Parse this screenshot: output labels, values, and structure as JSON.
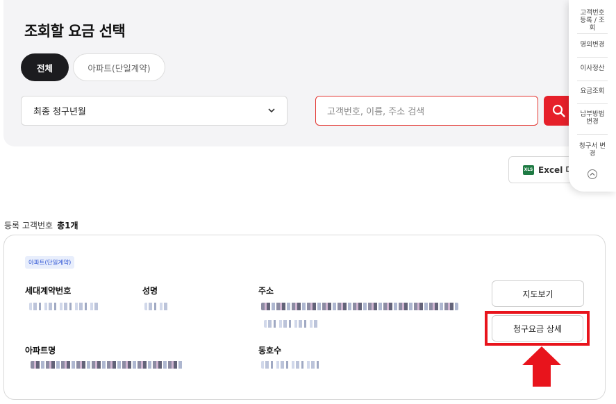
{
  "panel": {
    "title": "조회할 요금 선택",
    "tabs": [
      {
        "label": "전체",
        "active": true
      },
      {
        "label": "아파트(단일계약)",
        "active": false
      }
    ],
    "period_select": {
      "value": "최종 청구년월"
    },
    "search": {
      "placeholder": "고객번호, 이름, 주소 검색"
    }
  },
  "excel": {
    "label": "Excel 다"
  },
  "quick_menu": {
    "items": [
      {
        "label": "고객번호 등록 / 조회"
      },
      {
        "label": "명의변경"
      },
      {
        "label": "이사정산"
      },
      {
        "label": "요금조회"
      },
      {
        "label": "납부방법 변경"
      },
      {
        "label": "청구서 변경"
      }
    ]
  },
  "result": {
    "count_label": "등록 고객번호",
    "count_value": "총1개",
    "card": {
      "badge": "아파트(단일계약)",
      "fields": {
        "contract_no": "세대계약번호",
        "name": "성명",
        "address": "주소",
        "apartment": "아파트명",
        "unit": "동호수"
      },
      "map_button": "지도보기",
      "detail_button": "청구요금 상세"
    }
  },
  "colors": {
    "accent": "#e6202a",
    "dark": "#1c1c1f",
    "badge_text": "#2f55d4"
  }
}
